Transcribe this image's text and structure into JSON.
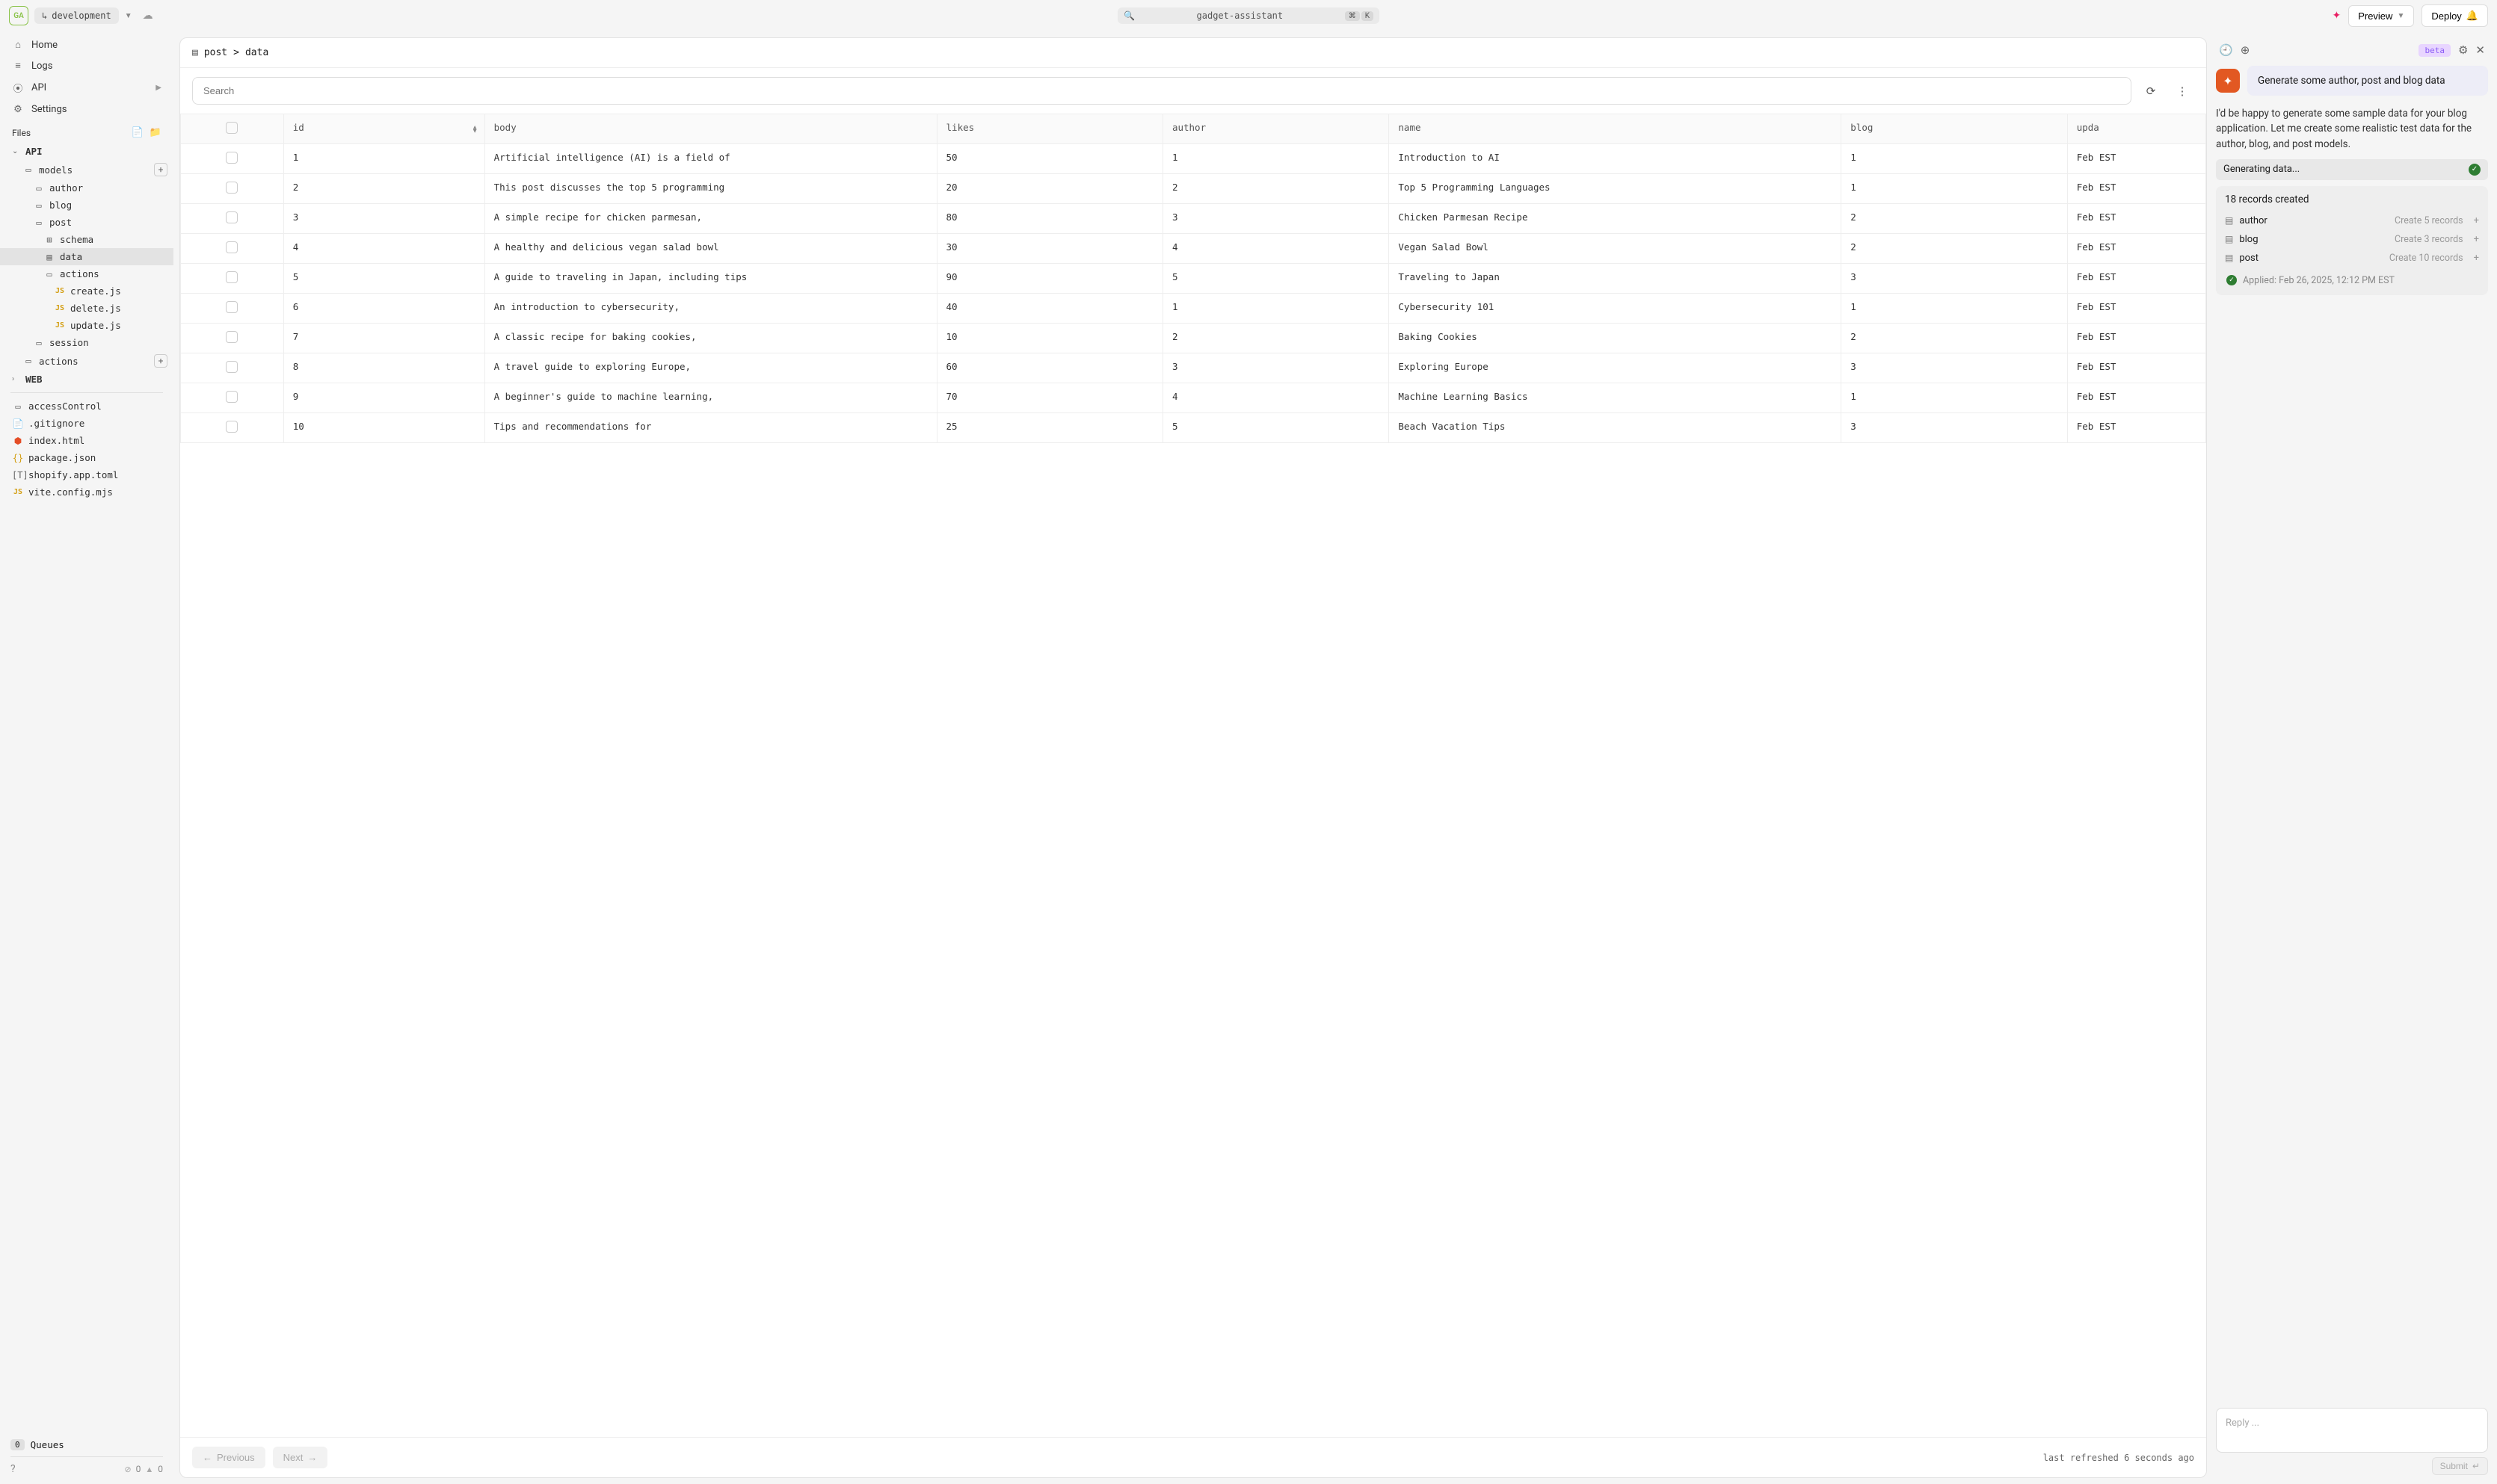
{
  "topbar": {
    "app_badge": "GA",
    "environment": "development",
    "app_name": "gadget-assistant",
    "cmd_key": "⌘",
    "k_key": "K",
    "preview": "Preview",
    "deploy": "Deploy"
  },
  "sidebar": {
    "nav": {
      "home": "Home",
      "logs": "Logs",
      "api": "API",
      "settings": "Settings"
    },
    "files_label": "Files",
    "api_section": "API",
    "models": "models",
    "author": "author",
    "blog": "blog",
    "post": "post",
    "schema": "schema",
    "data": "data",
    "actions": "actions",
    "create_js": "create.js",
    "delete_js": "delete.js",
    "update_js": "update.js",
    "session": "session",
    "root_actions": "actions",
    "web_section": "WEB",
    "accessControl": "accessControl",
    "gitignore": ".gitignore",
    "index_html": "index.html",
    "package_json": "package.json",
    "shopify_toml": "shopify.app.toml",
    "vite_config": "vite.config.mjs",
    "queues_count": "0",
    "queues_label": "Queues",
    "status_ok": "0",
    "status_warn": "0"
  },
  "breadcrumb": {
    "model": "post",
    "sep": ">",
    "page": "data"
  },
  "search_placeholder": "Search",
  "columns": {
    "id": "id",
    "body": "body",
    "likes": "likes",
    "author": "author",
    "name": "name",
    "blog": "blog",
    "upd": "upda"
  },
  "rows": [
    {
      "id": "1",
      "body": "Artificial intelligence (AI) is a field of",
      "likes": "50",
      "author": "1",
      "name": "Introduction to AI",
      "blog": "1",
      "upd": "Feb EST"
    },
    {
      "id": "2",
      "body": "This post discusses the top 5 programming",
      "likes": "20",
      "author": "2",
      "name": "Top 5 Programming Languages",
      "blog": "1",
      "upd": "Feb EST"
    },
    {
      "id": "3",
      "body": "A simple recipe for chicken parmesan,",
      "likes": "80",
      "author": "3",
      "name": "Chicken Parmesan Recipe",
      "blog": "2",
      "upd": "Feb EST"
    },
    {
      "id": "4",
      "body": "A healthy and delicious vegan salad bowl",
      "likes": "30",
      "author": "4",
      "name": "Vegan Salad Bowl",
      "blog": "2",
      "upd": "Feb EST"
    },
    {
      "id": "5",
      "body": "A guide to traveling in Japan, including tips",
      "likes": "90",
      "author": "5",
      "name": "Traveling to Japan",
      "blog": "3",
      "upd": "Feb EST"
    },
    {
      "id": "6",
      "body": "An introduction to cybersecurity,",
      "likes": "40",
      "author": "1",
      "name": "Cybersecurity 101",
      "blog": "1",
      "upd": "Feb EST"
    },
    {
      "id": "7",
      "body": "A classic recipe for baking cookies,",
      "likes": "10",
      "author": "2",
      "name": "Baking Cookies",
      "blog": "2",
      "upd": "Feb EST"
    },
    {
      "id": "8",
      "body": "A travel guide to exploring Europe,",
      "likes": "60",
      "author": "3",
      "name": "Exploring Europe",
      "blog": "3",
      "upd": "Feb EST"
    },
    {
      "id": "9",
      "body": "A beginner's guide to machine learning,",
      "likes": "70",
      "author": "4",
      "name": "Machine Learning Basics",
      "blog": "1",
      "upd": "Feb EST"
    },
    {
      "id": "10",
      "body": "Tips and recommendations for",
      "likes": "25",
      "author": "5",
      "name": "Beach Vacation Tips",
      "blog": "3",
      "upd": "Feb EST"
    }
  ],
  "footer": {
    "previous": "Previous",
    "next": "Next",
    "refreshed": "last refreshed 6 seconds ago"
  },
  "chat": {
    "beta": "beta",
    "prompt": "Generate some author, post and blog data",
    "assistant": "I'd be happy to generate some sample data for your blog application. Let me create some realistic test data for the author, blog, and post models.",
    "generating": "Generating data...",
    "records_created": "18 records created",
    "records": [
      {
        "name": "author",
        "action": "Create 5 records"
      },
      {
        "name": "blog",
        "action": "Create 3 records"
      },
      {
        "name": "post",
        "action": "Create 10 records"
      }
    ],
    "applied": "Applied: Feb 26, 2025, 12:12 PM EST",
    "reply_placeholder": "Reply ...",
    "submit": "Submit"
  }
}
